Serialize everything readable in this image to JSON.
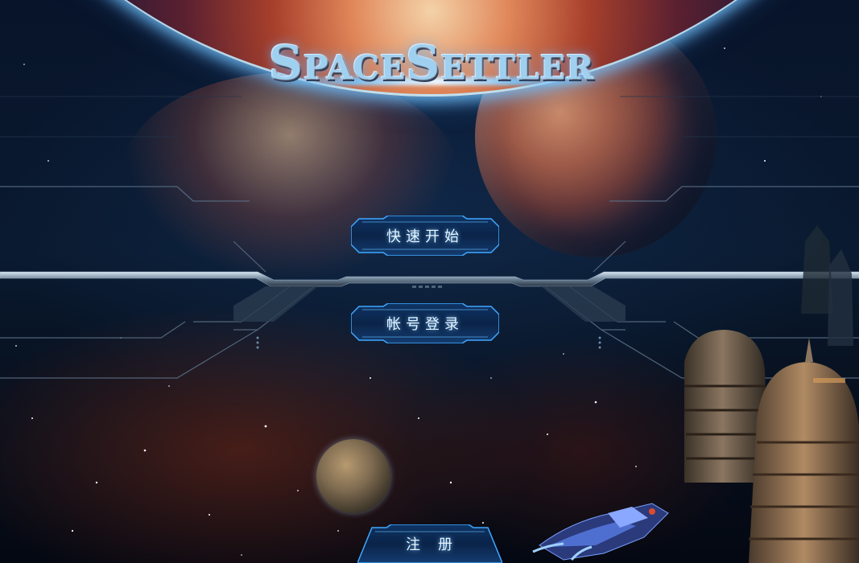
{
  "game": {
    "logo_text": "SpaceSettler"
  },
  "menu": {
    "quick_start_label": "快速开始",
    "account_login_label": "帐号登录",
    "register_label": "注册"
  },
  "colors": {
    "button_border": "#3fa8ff",
    "button_fill": "#0c2a52",
    "label": "#e8f4ff"
  }
}
